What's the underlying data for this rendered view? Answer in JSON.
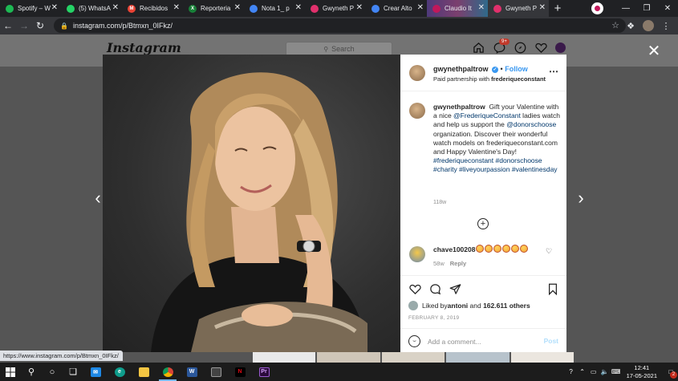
{
  "tabs": [
    {
      "title": "Spotify – W",
      "color": "#1db954",
      "glyph": "",
      "active": false
    },
    {
      "title": "(5) WhatsA",
      "color": "#25d366",
      "glyph": "",
      "active": false
    },
    {
      "title": "Recibidos",
      "color": "#ea4335",
      "glyph": "M",
      "active": false
    },
    {
      "title": "Reporteria",
      "color": "#188038",
      "glyph": "X",
      "active": false
    },
    {
      "title": "Nota 1_ p",
      "color": "#4285f4",
      "glyph": "",
      "active": false
    },
    {
      "title": "Gwyneth P",
      "color": "#e1306c",
      "glyph": "",
      "active": false
    },
    {
      "title": "Crear Alto",
      "color": "#4285f4",
      "glyph": "",
      "active": false
    },
    {
      "title": "Claudio It",
      "color": "#c2185b",
      "glyph": "",
      "active": false
    },
    {
      "title": "Gwyneth P",
      "color": "#e1306c",
      "glyph": "",
      "active": true
    }
  ],
  "browser": {
    "url": "instagram.com/p/Btmxn_0IFkz/",
    "status_url": "https://www.instagram.com/p/Btmxn_0IFkz/"
  },
  "instagram": {
    "logo": "Instagram",
    "search_placeholder": "Search",
    "notif_count": "9+"
  },
  "post": {
    "username": "gwynethpaltrow",
    "follow_label": "Follow",
    "paid_partnership_prefix": "Paid partnership with ",
    "partner": "frederiqueconstant",
    "caption_user": "gwynethpaltrow",
    "caption_parts": [
      {
        "text": " Gift your Valentine with a nice ",
        "link": false
      },
      {
        "text": "@FrederiqueConstant",
        "link": true
      },
      {
        "text": " ladies watch and help us support the ",
        "link": false
      },
      {
        "text": "@donorschoose",
        "link": true
      },
      {
        "text": " organization. Discover their wonderful watch models on frederiqueconstant.com and Happy Valentine's Day! ",
        "link": false
      },
      {
        "text": "#frederiqueconstant",
        "link": true
      },
      {
        "text": " ",
        "link": false
      },
      {
        "text": "#donorschoose",
        "link": true
      },
      {
        "text": " ",
        "link": false
      },
      {
        "text": "#charity",
        "link": true
      },
      {
        "text": " ",
        "link": false
      },
      {
        "text": "#liveyourpassion",
        "link": true
      },
      {
        "text": " ",
        "link": false
      },
      {
        "text": "#valentinesday",
        "link": true
      }
    ],
    "caption_time": "118w",
    "comment": {
      "user": "chave100208",
      "emoji_count": 6,
      "time": "58w",
      "reply_label": "Reply"
    },
    "liked_prefix": "Liked by ",
    "liked_user": "antoni",
    "liked_and": " and ",
    "liked_count": "162.611 others",
    "date": "FEBRUARY 8, 2019",
    "add_comment_placeholder": "Add a comment...",
    "post_label": "Post"
  },
  "taskbar": {
    "time": "12:41",
    "date": "17-05-2021",
    "notifications": "2"
  }
}
